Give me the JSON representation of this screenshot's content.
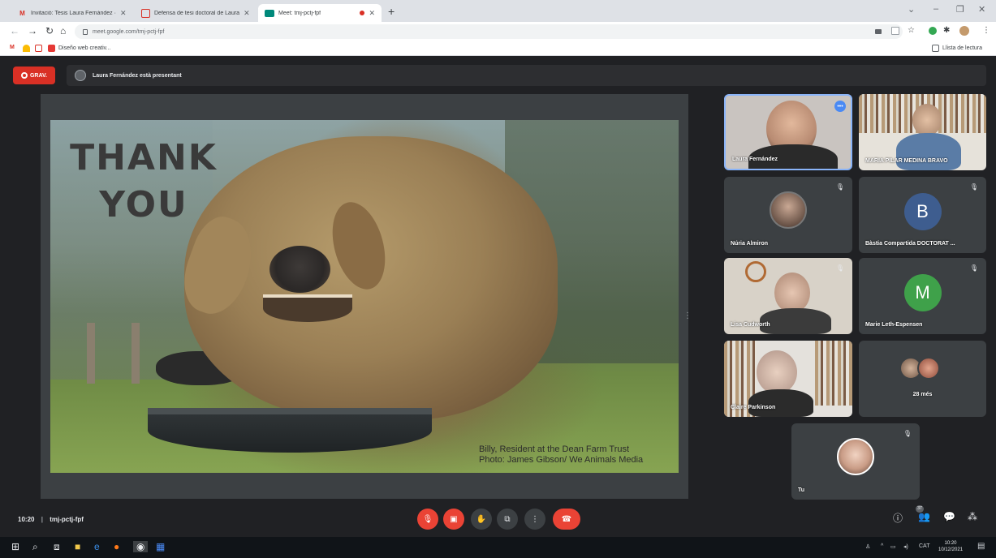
{
  "browser": {
    "tabs": [
      {
        "title": "Invitació: Tesis Laura Fernández ·",
        "icon": "gmail-icon"
      },
      {
        "title": "Defensa de tesi doctoral de Laura",
        "icon": "calendar-icon"
      },
      {
        "title": "Meet: tmj-pctj-fpf",
        "icon": "meet-icon"
      }
    ],
    "url": "meet.google.com/tmj-pctj-fpf",
    "bookmarks": [
      {
        "label": "Diseño web creativ..."
      }
    ],
    "reading_list_label": "Llista de lectura"
  },
  "meet": {
    "rec_label": "GRAV.",
    "presenting_text": "Laura Fernández està presentant",
    "slide": {
      "heading_line1": "THANK",
      "heading_line2": "YOU",
      "credit_line1": "Billy, Resident at the Dean Farm Trust",
      "credit_line2": "Photo: James Gibson/ We Animals Media"
    },
    "participants": [
      {
        "name": "Laura Fernández"
      },
      {
        "name": "MARIA PILAR MEDINA BRAVO"
      },
      {
        "name": "Núria Almiron"
      },
      {
        "name": "Bàstia Compartida DOCTORAT ...",
        "initial": "B",
        "color": "#3e5d8f"
      },
      {
        "name": "Lisa Cudworth"
      },
      {
        "name": "Marie Leth-Espensen",
        "initial": "M",
        "color": "#3fa14a"
      },
      {
        "name": "Claire Parkinson"
      },
      {
        "name": "28 més"
      },
      {
        "name": "Tu"
      }
    ],
    "time": "10:20",
    "separator": "|",
    "meeting_code": "tmj-pctj-fpf",
    "people_count": "37"
  },
  "taskbar": {
    "language": "CAT",
    "clock_time": "10:20",
    "clock_date": "10/12/2021"
  }
}
